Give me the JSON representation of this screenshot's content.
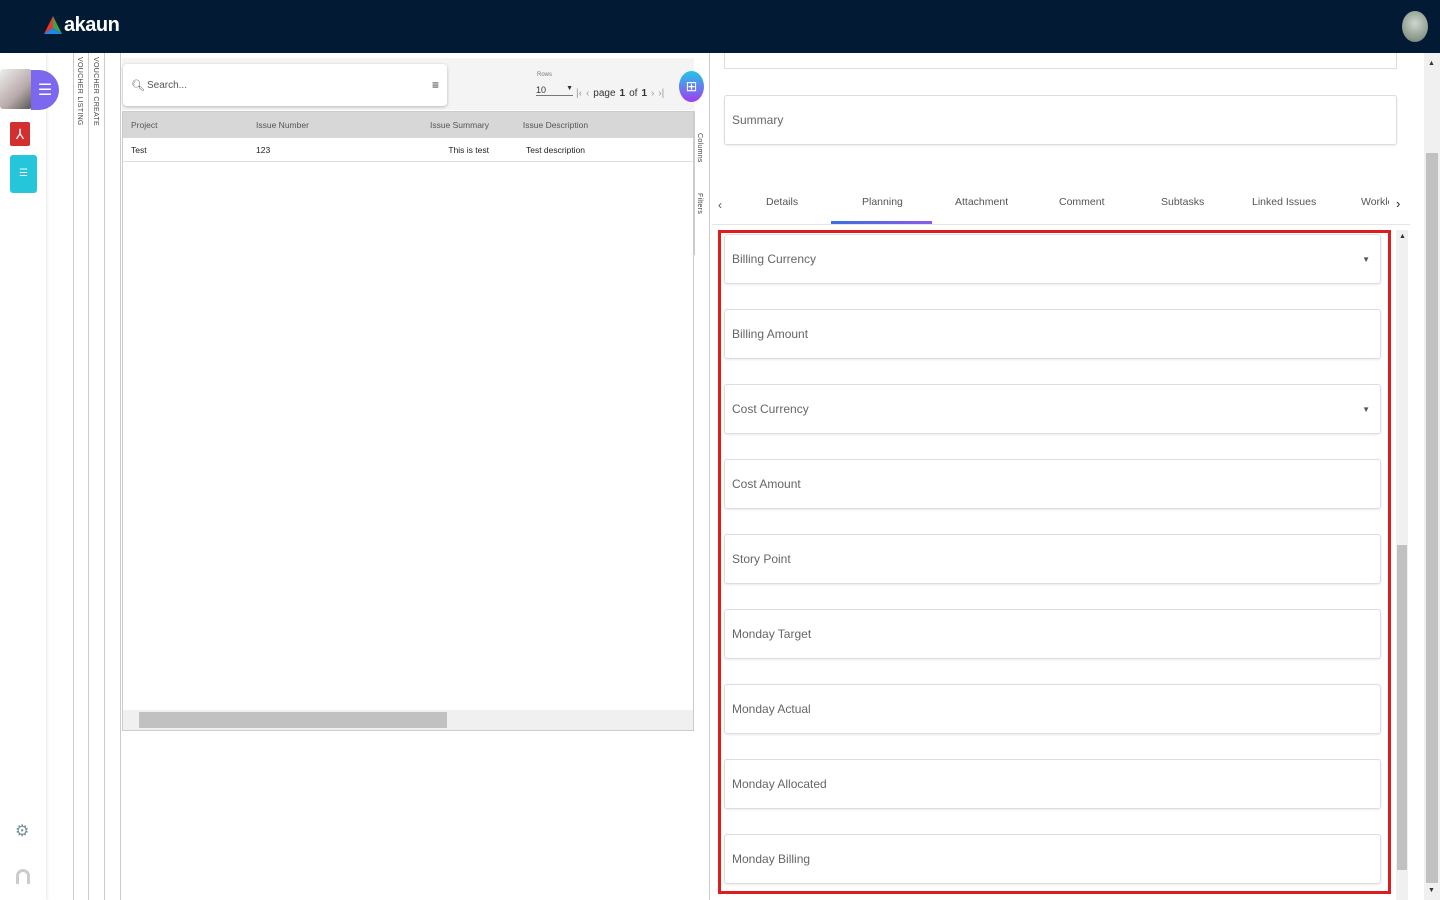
{
  "brand": {
    "name": "akaun"
  },
  "side_tabs": [
    "VOUCHER LISTING",
    "VOUCHER CREATE"
  ],
  "list": {
    "search_placeholder": "Search...",
    "rows_label": "Rows",
    "rows_value": "10",
    "page_word": "page",
    "page": "1",
    "of_word": "of",
    "total_pages": "1",
    "columns": [
      "Project",
      "Issue Number",
      "Issue Summary",
      "Issue Description"
    ],
    "rows": [
      [
        "Test",
        "123",
        "This is test",
        "Test description"
      ]
    ],
    "side_buttons": [
      "Columns",
      "Filters"
    ]
  },
  "detail": {
    "summary_label": "Summary",
    "tabs": [
      "Details",
      "Planning",
      "Attachment",
      "Comment",
      "Subtasks",
      "Linked Issues",
      "Worklo"
    ],
    "active_tab": "Planning",
    "fields": [
      {
        "label": "Billing Currency",
        "dropdown": true
      },
      {
        "label": "Billing Amount",
        "dropdown": false
      },
      {
        "label": "Cost Currency",
        "dropdown": true
      },
      {
        "label": "Cost Amount",
        "dropdown": false
      },
      {
        "label": "Story Point",
        "dropdown": false
      },
      {
        "label": "Monday Target",
        "dropdown": false
      },
      {
        "label": "Monday Actual",
        "dropdown": false
      },
      {
        "label": "Monday Allocated",
        "dropdown": false
      },
      {
        "label": "Monday Billing",
        "dropdown": false
      }
    ]
  },
  "colors": {
    "topbar": "#021a33",
    "highlight": "#e01b1b",
    "tab_indicator": "#5b5ce2"
  }
}
